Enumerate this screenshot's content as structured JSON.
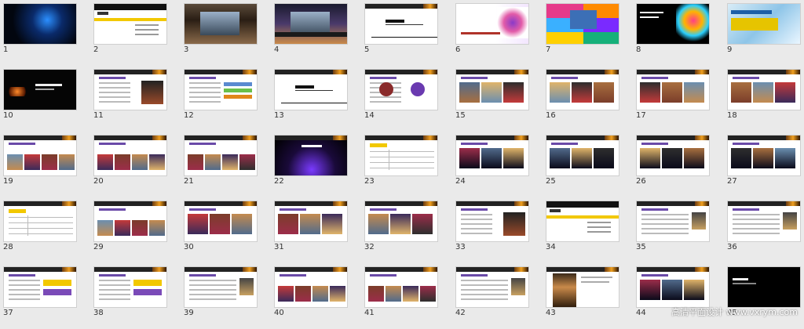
{
  "slides": [
    {
      "n": "1",
      "kind": "dark-blue"
    },
    {
      "n": "2",
      "kind": "toc"
    },
    {
      "n": "3",
      "kind": "photo-building"
    },
    {
      "n": "4",
      "kind": "photo-building-night"
    },
    {
      "n": "5",
      "kind": "title-white"
    },
    {
      "n": "6",
      "kind": "floral"
    },
    {
      "n": "7",
      "kind": "color-blocks"
    },
    {
      "n": "8",
      "kind": "black-colorful"
    },
    {
      "n": "9",
      "kind": "water"
    },
    {
      "n": "10",
      "kind": "dark-fire"
    },
    {
      "n": "11",
      "kind": "text-photo"
    },
    {
      "n": "12",
      "kind": "people-bars"
    },
    {
      "n": "13",
      "kind": "title-white"
    },
    {
      "n": "14",
      "kind": "two-circles"
    },
    {
      "n": "15",
      "kind": "grid-photos"
    },
    {
      "n": "16",
      "kind": "grid-photos"
    },
    {
      "n": "17",
      "kind": "grid-photos"
    },
    {
      "n": "18",
      "kind": "grid-photos"
    },
    {
      "n": "19",
      "kind": "photo-strip"
    },
    {
      "n": "20",
      "kind": "photo-strip"
    },
    {
      "n": "21",
      "kind": "photo-strip"
    },
    {
      "n": "22",
      "kind": "stage-black"
    },
    {
      "n": "23",
      "kind": "table"
    },
    {
      "n": "24",
      "kind": "grid-photos-dark"
    },
    {
      "n": "25",
      "kind": "grid-photos-dark"
    },
    {
      "n": "26",
      "kind": "grid-photos-dark"
    },
    {
      "n": "27",
      "kind": "grid-photos-dark"
    },
    {
      "n": "28",
      "kind": "table"
    },
    {
      "n": "29",
      "kind": "photo-strip"
    },
    {
      "n": "30",
      "kind": "grid-photos"
    },
    {
      "n": "31",
      "kind": "grid-photos"
    },
    {
      "n": "32",
      "kind": "grid-photos"
    },
    {
      "n": "33",
      "kind": "text-photo"
    },
    {
      "n": "34",
      "kind": "toc"
    },
    {
      "n": "35",
      "kind": "text-lists"
    },
    {
      "n": "36",
      "kind": "text-lists"
    },
    {
      "n": "37",
      "kind": "diagram"
    },
    {
      "n": "38",
      "kind": "diagram"
    },
    {
      "n": "39",
      "kind": "text-lists"
    },
    {
      "n": "40",
      "kind": "photo-strip"
    },
    {
      "n": "41",
      "kind": "photo-strip"
    },
    {
      "n": "42",
      "kind": "text-lists"
    },
    {
      "n": "43",
      "kind": "violin"
    },
    {
      "n": "44",
      "kind": "grid-photos-dark"
    },
    {
      "n": "45",
      "kind": "black"
    }
  ],
  "watermark": "高清平面设计 www.vxrym.com"
}
